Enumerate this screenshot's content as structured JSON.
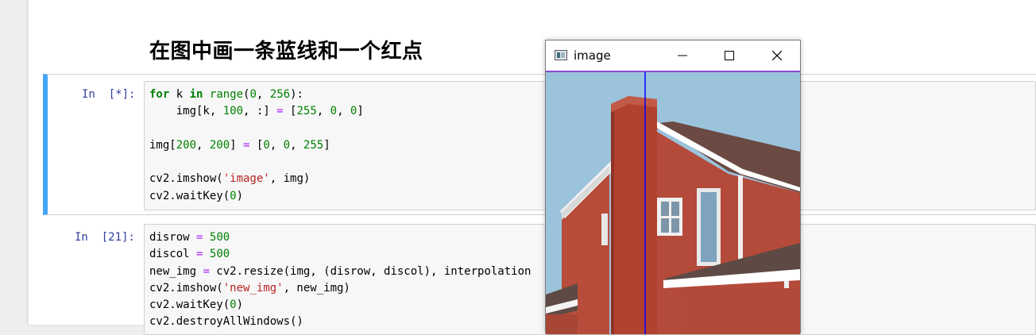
{
  "notebook": {
    "heading": "在图中画一条蓝线和一个红点",
    "cells": [
      {
        "prompt": "In  [*]:",
        "lines": [
          "for k in range(0, 256):",
          "    img[k, 100, :] = [255, 0, 0]",
          "",
          "img[200, 200] = [0, 0, 255]",
          "",
          "cv2.imshow('image', img)",
          "cv2.waitKey(0)"
        ]
      },
      {
        "prompt": "In  [21]:",
        "lines": [
          "disrow = 500",
          "discol = 500",
          "new_img = cv2.resize(img, (disrow, discol), interpolation",
          "cv2.imshow('new_img', new_img)",
          "cv2.waitKey(0)",
          "cv2.destroyAllWindows()"
        ]
      }
    ]
  },
  "window": {
    "title": "image",
    "controls": {
      "minimize_icon": "minimize-icon",
      "maximize_icon": "maximize-icon",
      "close_icon": "close-icon"
    },
    "image_description_icon": "house-photo"
  },
  "colors": {
    "active_cell_bar": "#42a5f5",
    "prompt": "#303f9f",
    "keyword": "#008000",
    "string": "#ba2121",
    "operator": "#aa22ff",
    "drawn_line": "#0000ff"
  }
}
